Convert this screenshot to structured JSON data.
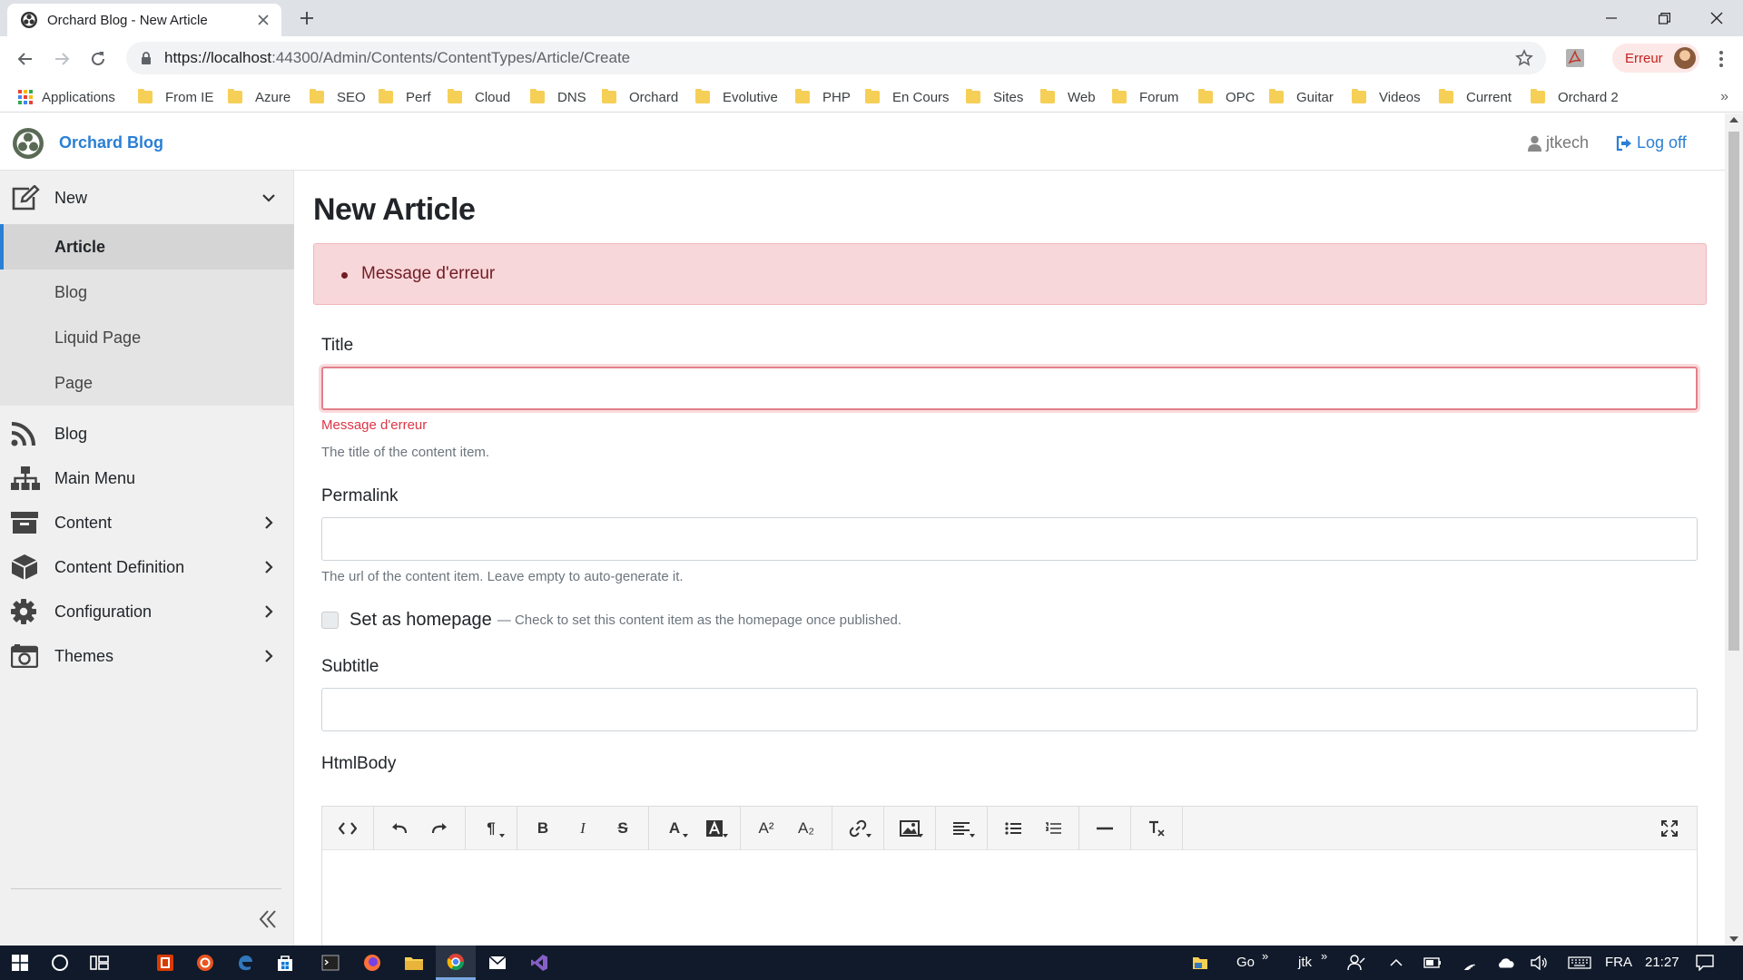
{
  "browser": {
    "tab_title": "Orchard Blog - New Article",
    "url_host": "https://localhost",
    "url_rest": ":44300/Admin/Contents/ContentTypes/Article/Create",
    "profile_label": "Erreur"
  },
  "bookmarks": {
    "apps_label": "Applications",
    "items": [
      {
        "label": "From IE"
      },
      {
        "label": "Azure"
      },
      {
        "label": "SEO"
      },
      {
        "label": "Perf"
      },
      {
        "label": "Cloud"
      },
      {
        "label": "DNS"
      },
      {
        "label": "Orchard"
      },
      {
        "label": "Evolutive"
      },
      {
        "label": "PHP"
      },
      {
        "label": "En Cours"
      },
      {
        "label": "Sites"
      },
      {
        "label": "Web"
      },
      {
        "label": "Forum"
      },
      {
        "label": "OPC"
      },
      {
        "label": "Guitar"
      },
      {
        "label": "Videos"
      },
      {
        "label": "Current"
      },
      {
        "label": "Orchard 2"
      }
    ],
    "more_label": "»"
  },
  "header": {
    "brand": "Orchard Blog",
    "user": "jtkech",
    "logoff": "Log off"
  },
  "sidebar": {
    "new_label": "New",
    "submenu": [
      {
        "label": "Article"
      },
      {
        "label": "Blog"
      },
      {
        "label": "Liquid Page"
      },
      {
        "label": "Page"
      }
    ],
    "items": [
      {
        "label": "Blog"
      },
      {
        "label": "Main Menu"
      },
      {
        "label": "Content"
      },
      {
        "label": "Content Definition"
      },
      {
        "label": "Configuration"
      },
      {
        "label": "Themes"
      }
    ]
  },
  "main": {
    "title": "New Article",
    "alert_message": "Message d'erreur",
    "title_label": "Title",
    "title_value": "",
    "title_error": "Message d'erreur",
    "title_hint": "The title of the content item.",
    "permalink_label": "Permalink",
    "permalink_value": "",
    "permalink_hint": "The url of the content item. Leave empty to auto-generate it.",
    "homepage_label": "Set as homepage",
    "homepage_hint": "— Check to set this content item as the homepage once published.",
    "homepage_checked": false,
    "subtitle_label": "Subtitle",
    "subtitle_value": "",
    "htmlbody_label": "HtmlBody"
  },
  "editor_toolbar": {
    "paragraph": "¶",
    "bold": "B",
    "italic": "I",
    "strike": "S",
    "font_color": "A",
    "superscript": "A²",
    "subscript": "A₂"
  },
  "taskbar": {
    "go_label": "Go",
    "jtk_label": "jtk",
    "language": "FRA",
    "time": "21:27"
  },
  "colors": {
    "accent": "#2a7fd4",
    "error": "#dc3545",
    "alert_bg": "#f8d7da",
    "sidebar_bg": "#f0f0f0"
  }
}
